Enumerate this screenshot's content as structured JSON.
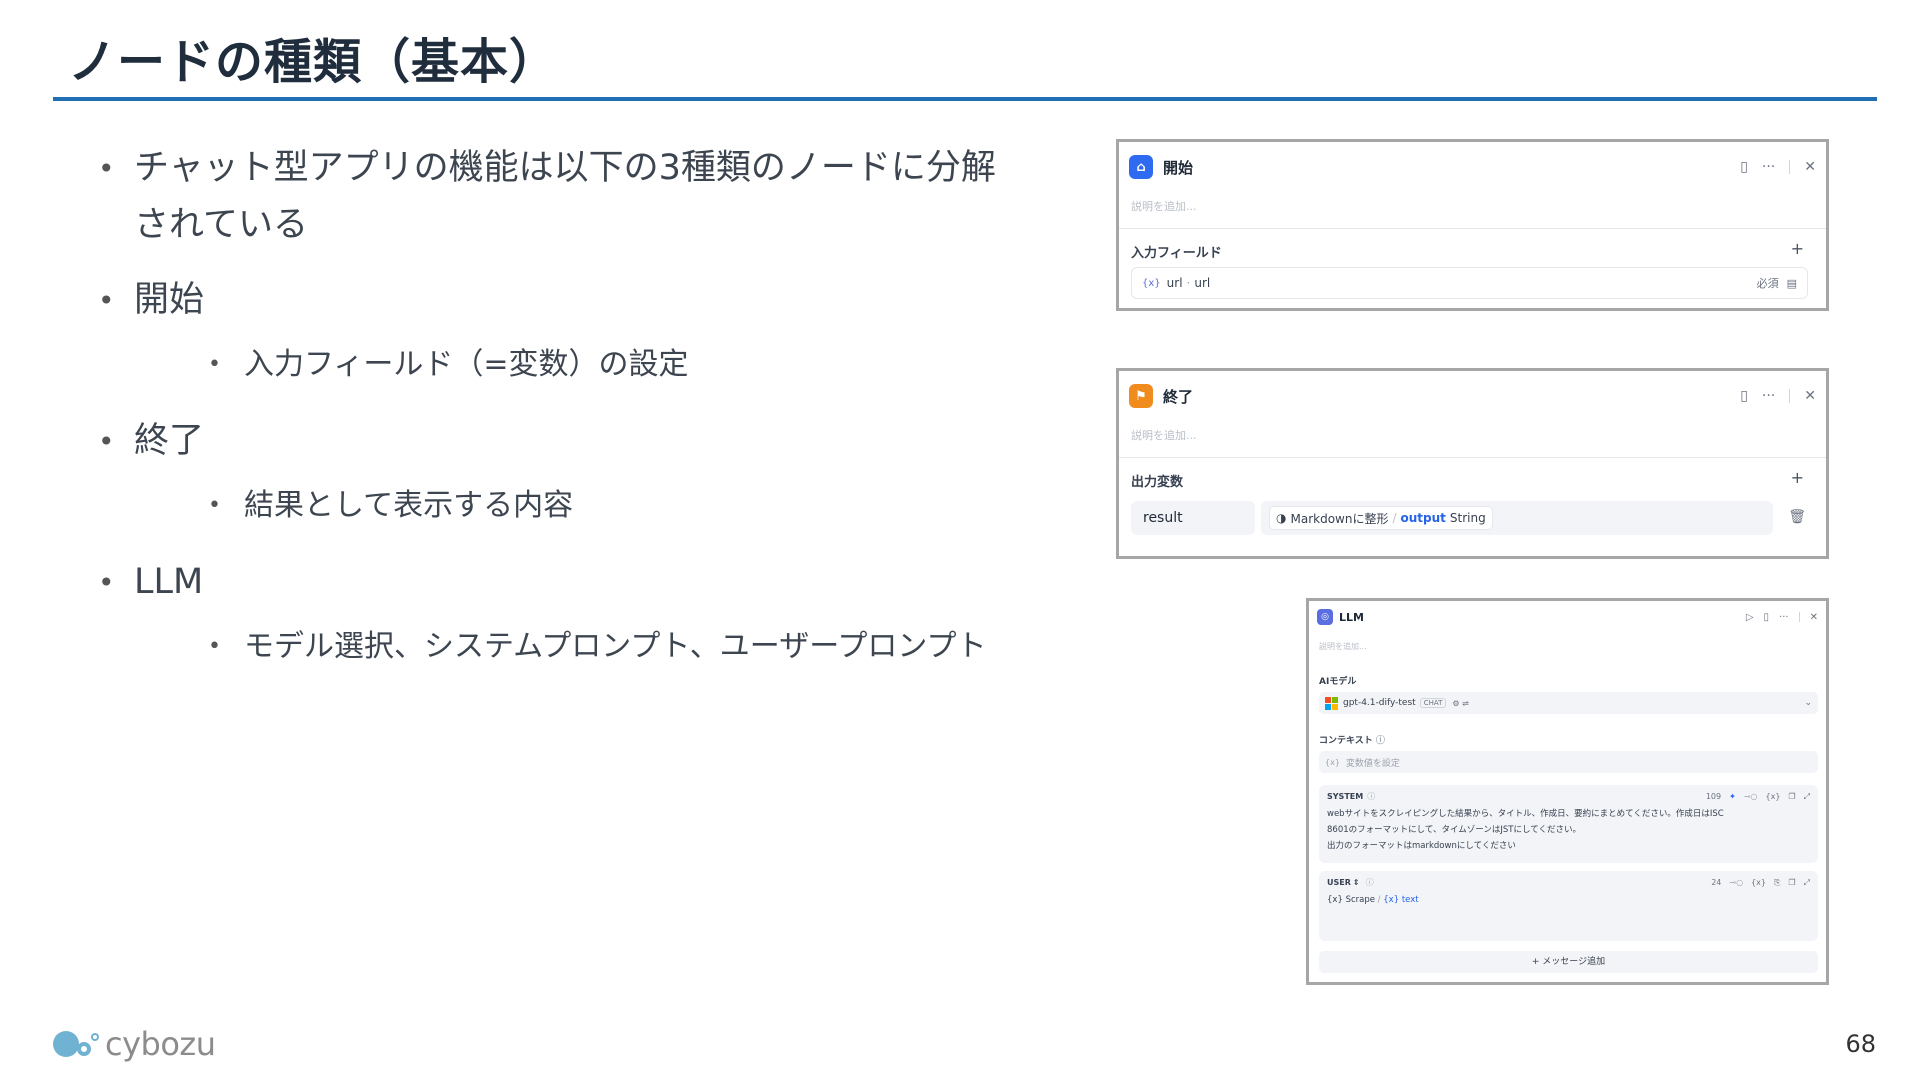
{
  "slide": {
    "title": "ノードの種類（基本）",
    "page_number": "68",
    "logo_text": "cybozu",
    "accent_color": "#1f6fb2"
  },
  "bullets": {
    "b1": "チャット型アプリの機能は以下の3種類のノードに分解されている",
    "b2": "開始",
    "b2_sub": "入力フィールド（=変数）の設定",
    "b3": "終了",
    "b3_sub": "結果として表示する内容",
    "b4": "LLM",
    "b4_sub": "モデル選択、システムプロンプト、ユーザープロンプト"
  },
  "start_panel": {
    "title": "開始",
    "icon": "home-icon",
    "icon_color": "#2f6bf0",
    "description_placeholder": "説明を追加...",
    "section_label": "入力フィールド",
    "add": "+",
    "field_glyph": "{x}",
    "field_name": "url",
    "field_sep": "·",
    "field_label": "url",
    "required": "必須",
    "close": "✕",
    "more": "···"
  },
  "end_panel": {
    "title": "終了",
    "icon": "flag-icon",
    "icon_color": "#f08c1e",
    "description_placeholder": "説明を追加...",
    "section_label": "出力変数",
    "add": "+",
    "output_name": "result",
    "source_node": "Markdownに整形",
    "slash": "/",
    "var_name": "output",
    "var_type": "String",
    "close": "✕",
    "more": "···"
  },
  "llm_panel": {
    "title": "LLM",
    "icon": "llm-icon",
    "icon_color": "#5b6ee1",
    "description_placeholder": "説明を追加...",
    "model_label": "AIモデル",
    "model_name": "gpt-4.1-dify-test",
    "model_badge": "CHAT",
    "context_label": "コンテキスト",
    "context_placeholder": "変数値を設定",
    "system_label": "SYSTEM",
    "system_tokens": "109",
    "system_text_1": "webサイトをスクレイピングした結果から、タイトル、作成日、要約にまとめてください。作成日はISC",
    "system_text_2": "8601のフォーマットにして、タイムゾーンはJSTにしてください。",
    "system_text_3": "出力のフォーマットはmarkdownにしてください",
    "user_label": "USER",
    "user_tokens": "24",
    "user_var_1": "Scrape",
    "user_var_2": "text",
    "add_message": "+ メッセージ追加",
    "close": "✕",
    "more": "···",
    "run": "▷"
  }
}
